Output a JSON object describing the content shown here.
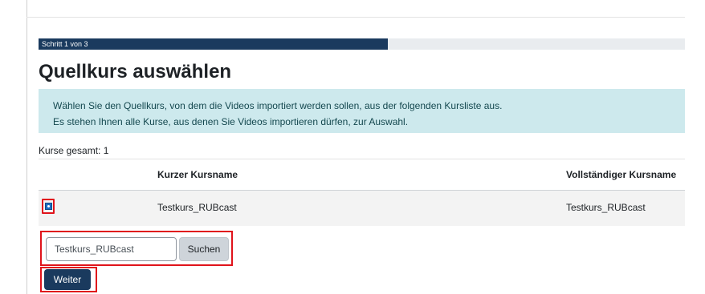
{
  "progress": {
    "label": "Schritt 1 von 3",
    "fraction": 0.54
  },
  "page": {
    "title": "Quellkurs auswählen"
  },
  "info": {
    "line1": "Wählen Sie den Quellkurs, von dem die Videos importiert werden sollen, aus der folgenden Kursliste aus.",
    "line2": "Es stehen Ihnen alle Kurse, aus denen Sie Videos importieren dürfen, zur Auswahl."
  },
  "courses": {
    "total_label": "Kurse gesamt: 1",
    "columns": {
      "shortname": "Kurzer Kursname",
      "fullname": "Vollständiger Kursname"
    },
    "rows": [
      {
        "shortname": "Testkurs_RUBcast",
        "fullname": "Testkurs_RUBcast",
        "selected": true
      }
    ]
  },
  "search": {
    "value": "Testkurs_RUBcast",
    "button_label": "Suchen"
  },
  "actions": {
    "next_label": "Weiter"
  },
  "colors": {
    "primary": "#1a3a5e",
    "info_bg": "#cde9ed",
    "highlight": "#e0131b"
  }
}
